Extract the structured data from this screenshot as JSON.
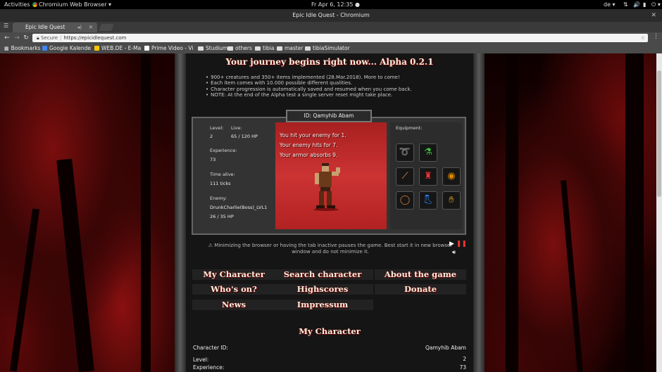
{
  "desktop": {
    "activities": "Activities",
    "app_menu": "Chromium Web Browser ▾",
    "clock": "Fr Apr  6, 12:35 ●",
    "lang": "de ▾",
    "tray_icons": [
      "network-icon",
      "volume-icon",
      "battery-icon",
      "power-icon"
    ]
  },
  "window": {
    "title": "Epic Idle Quest - Chromium"
  },
  "browser": {
    "tab_title": "Epic Idle Quest",
    "secure_label": "Secure",
    "url": "https://epicidlequest.com",
    "bookmarks": [
      "Bookmarks",
      "Google Kalende",
      "WEB.DE - E-Ma",
      "Prime Video - Vi",
      "Studium",
      "others",
      "tibia",
      "master",
      "tibiaSimulator"
    ]
  },
  "page": {
    "headline": "Your journey begins right now... Alpha 0.2.1",
    "notes": [
      "900+ creatures and 350+ items implemented (28.Mar.2018). More to come!",
      "Each item comes with 10.000 possible different qualities.",
      "Character progression is automatically saved and resumed when you come back.",
      "NOTE: At the end of the Alpha test a single server reset might take place."
    ],
    "game": {
      "id_label": "ID: Qamyhib Abam",
      "level_label": "Level:",
      "level": "2",
      "live_label": "Live:",
      "live": "65 / 120 HP",
      "experience_label": "Experience:",
      "experience": "73",
      "time_alive_label": "Time alive:",
      "time_alive": "111 ticks",
      "enemy_label": "Enemy:",
      "enemy_name": "DrunkCharlie(Boss)_LVL1",
      "enemy_hp": "26 / 35 HP",
      "battle_log": [
        "You hit your enemy for 1.",
        "Your enemy hits for 7.",
        "Your armor absorbs 9."
      ],
      "equipment_label": "Equipment:"
    },
    "warning_line1": "⚠ Minimizing the browser or having the tab inactive pauses the game. Best start it in new browser",
    "warning_line2": "window and do not minimize it.",
    "nav": {
      "my_character": "My Character",
      "search_character": "Search character",
      "about": "About the game",
      "whos_on": "Who's on?",
      "highscores": "Highscores",
      "donate": "Donate",
      "news": "News",
      "impressum": "Impressum"
    },
    "section_title": "My Character",
    "details": [
      {
        "label": "Character ID:",
        "value": "Qamyhib Abam"
      },
      {
        "label": "",
        "value": "2"
      },
      {
        "label": "Level:",
        "value": ""
      },
      {
        "label": "Experience:",
        "value": "73"
      }
    ]
  }
}
